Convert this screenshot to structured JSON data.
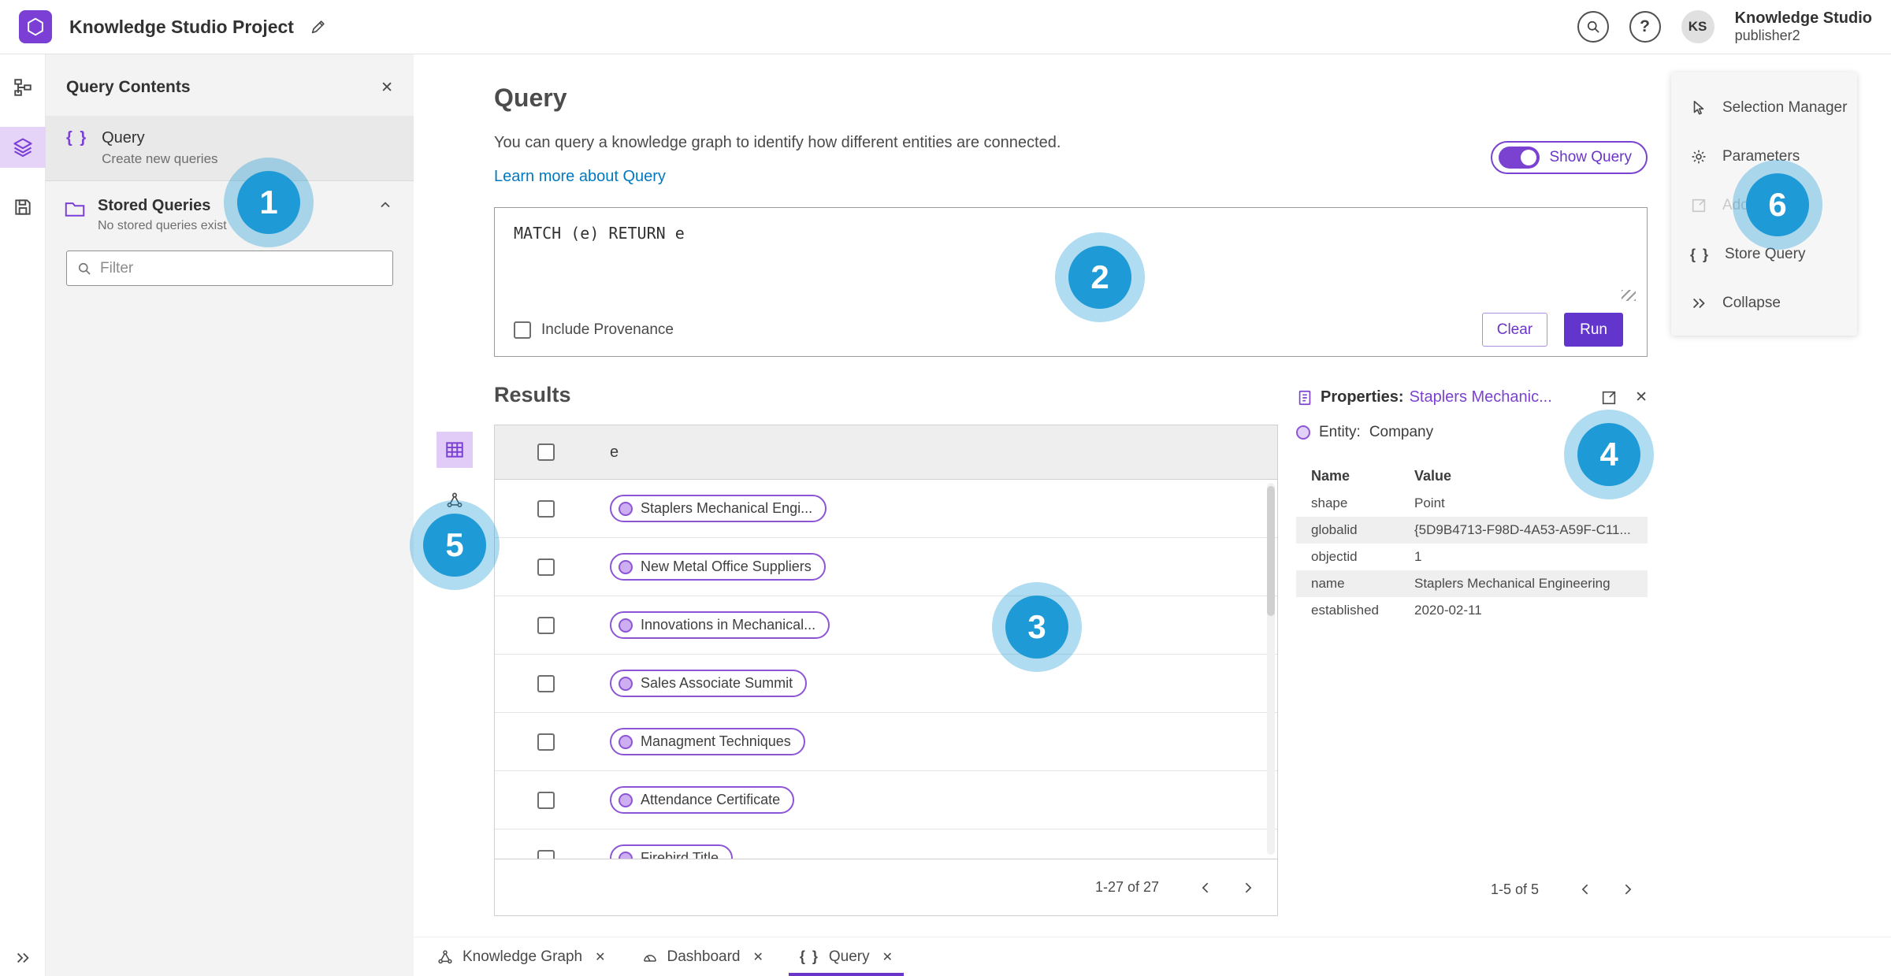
{
  "colors": {
    "accent_purple": "#7b42d1",
    "run_button": "#6236cc",
    "link_blue": "#0079c1",
    "badge_blue": "#1e9ad6"
  },
  "icons": {
    "close": "✕",
    "braces": "{ }",
    "help": "?"
  },
  "header": {
    "title": "Knowledge Studio Project",
    "user": {
      "initials": "KS",
      "name": "Knowledge Studio",
      "role": "publisher2"
    }
  },
  "left_panel": {
    "title": "Query Contents",
    "query_item": {
      "label": "Query",
      "sublabel": "Create new queries"
    },
    "stored_queries": {
      "label": "Stored Queries",
      "sublabel": "No stored queries exist"
    },
    "filter_placeholder": "Filter"
  },
  "query_section": {
    "title": "Query",
    "description": "You can query a knowledge graph to identify how different entities are connected.",
    "learn_more": "Learn more about Query",
    "show_query_label": "Show Query",
    "query_text": "MATCH (e) RETURN e",
    "include_provenance_label": "Include Provenance",
    "clear_label": "Clear",
    "run_label": "Run"
  },
  "results": {
    "title": "Results",
    "column": "e",
    "rows": [
      "Staplers Mechanical Engi...",
      "New Metal Office Suppliers",
      "Innovations in Mechanical...",
      "Sales Associate Summit",
      "Managment Techniques",
      "Attendance Certificate",
      "Firebird Title"
    ],
    "pagination": "1-27 of 27"
  },
  "properties": {
    "title_label": "Properties:",
    "entity_link": "Staplers Mechanic...",
    "entity_label": "Entity:",
    "entity_value": "Company",
    "columns": [
      "Name",
      "Value"
    ],
    "rows": [
      {
        "name": "shape",
        "value": "Point"
      },
      {
        "name": "globalid",
        "value": "{5D9B4713-F98D-4A53-A59F-C11..."
      },
      {
        "name": "objectid",
        "value": "1"
      },
      {
        "name": "name",
        "value": "Staplers Mechanical Engineering"
      },
      {
        "name": "established",
        "value": "2020-02-11"
      }
    ],
    "pagination": "1-5 of 5"
  },
  "tools_menu": {
    "items": [
      {
        "label": "Selection Manager"
      },
      {
        "label": "Parameters"
      },
      {
        "label": "Add",
        "disabled": true
      },
      {
        "label": "Store Query"
      },
      {
        "label": "Collapse"
      }
    ]
  },
  "bottom_tabs": [
    {
      "label": "Knowledge Graph"
    },
    {
      "label": "Dashboard"
    },
    {
      "label": "Query",
      "active": true
    }
  ],
  "badges": [
    "1",
    "2",
    "3",
    "4",
    "5",
    "6"
  ]
}
